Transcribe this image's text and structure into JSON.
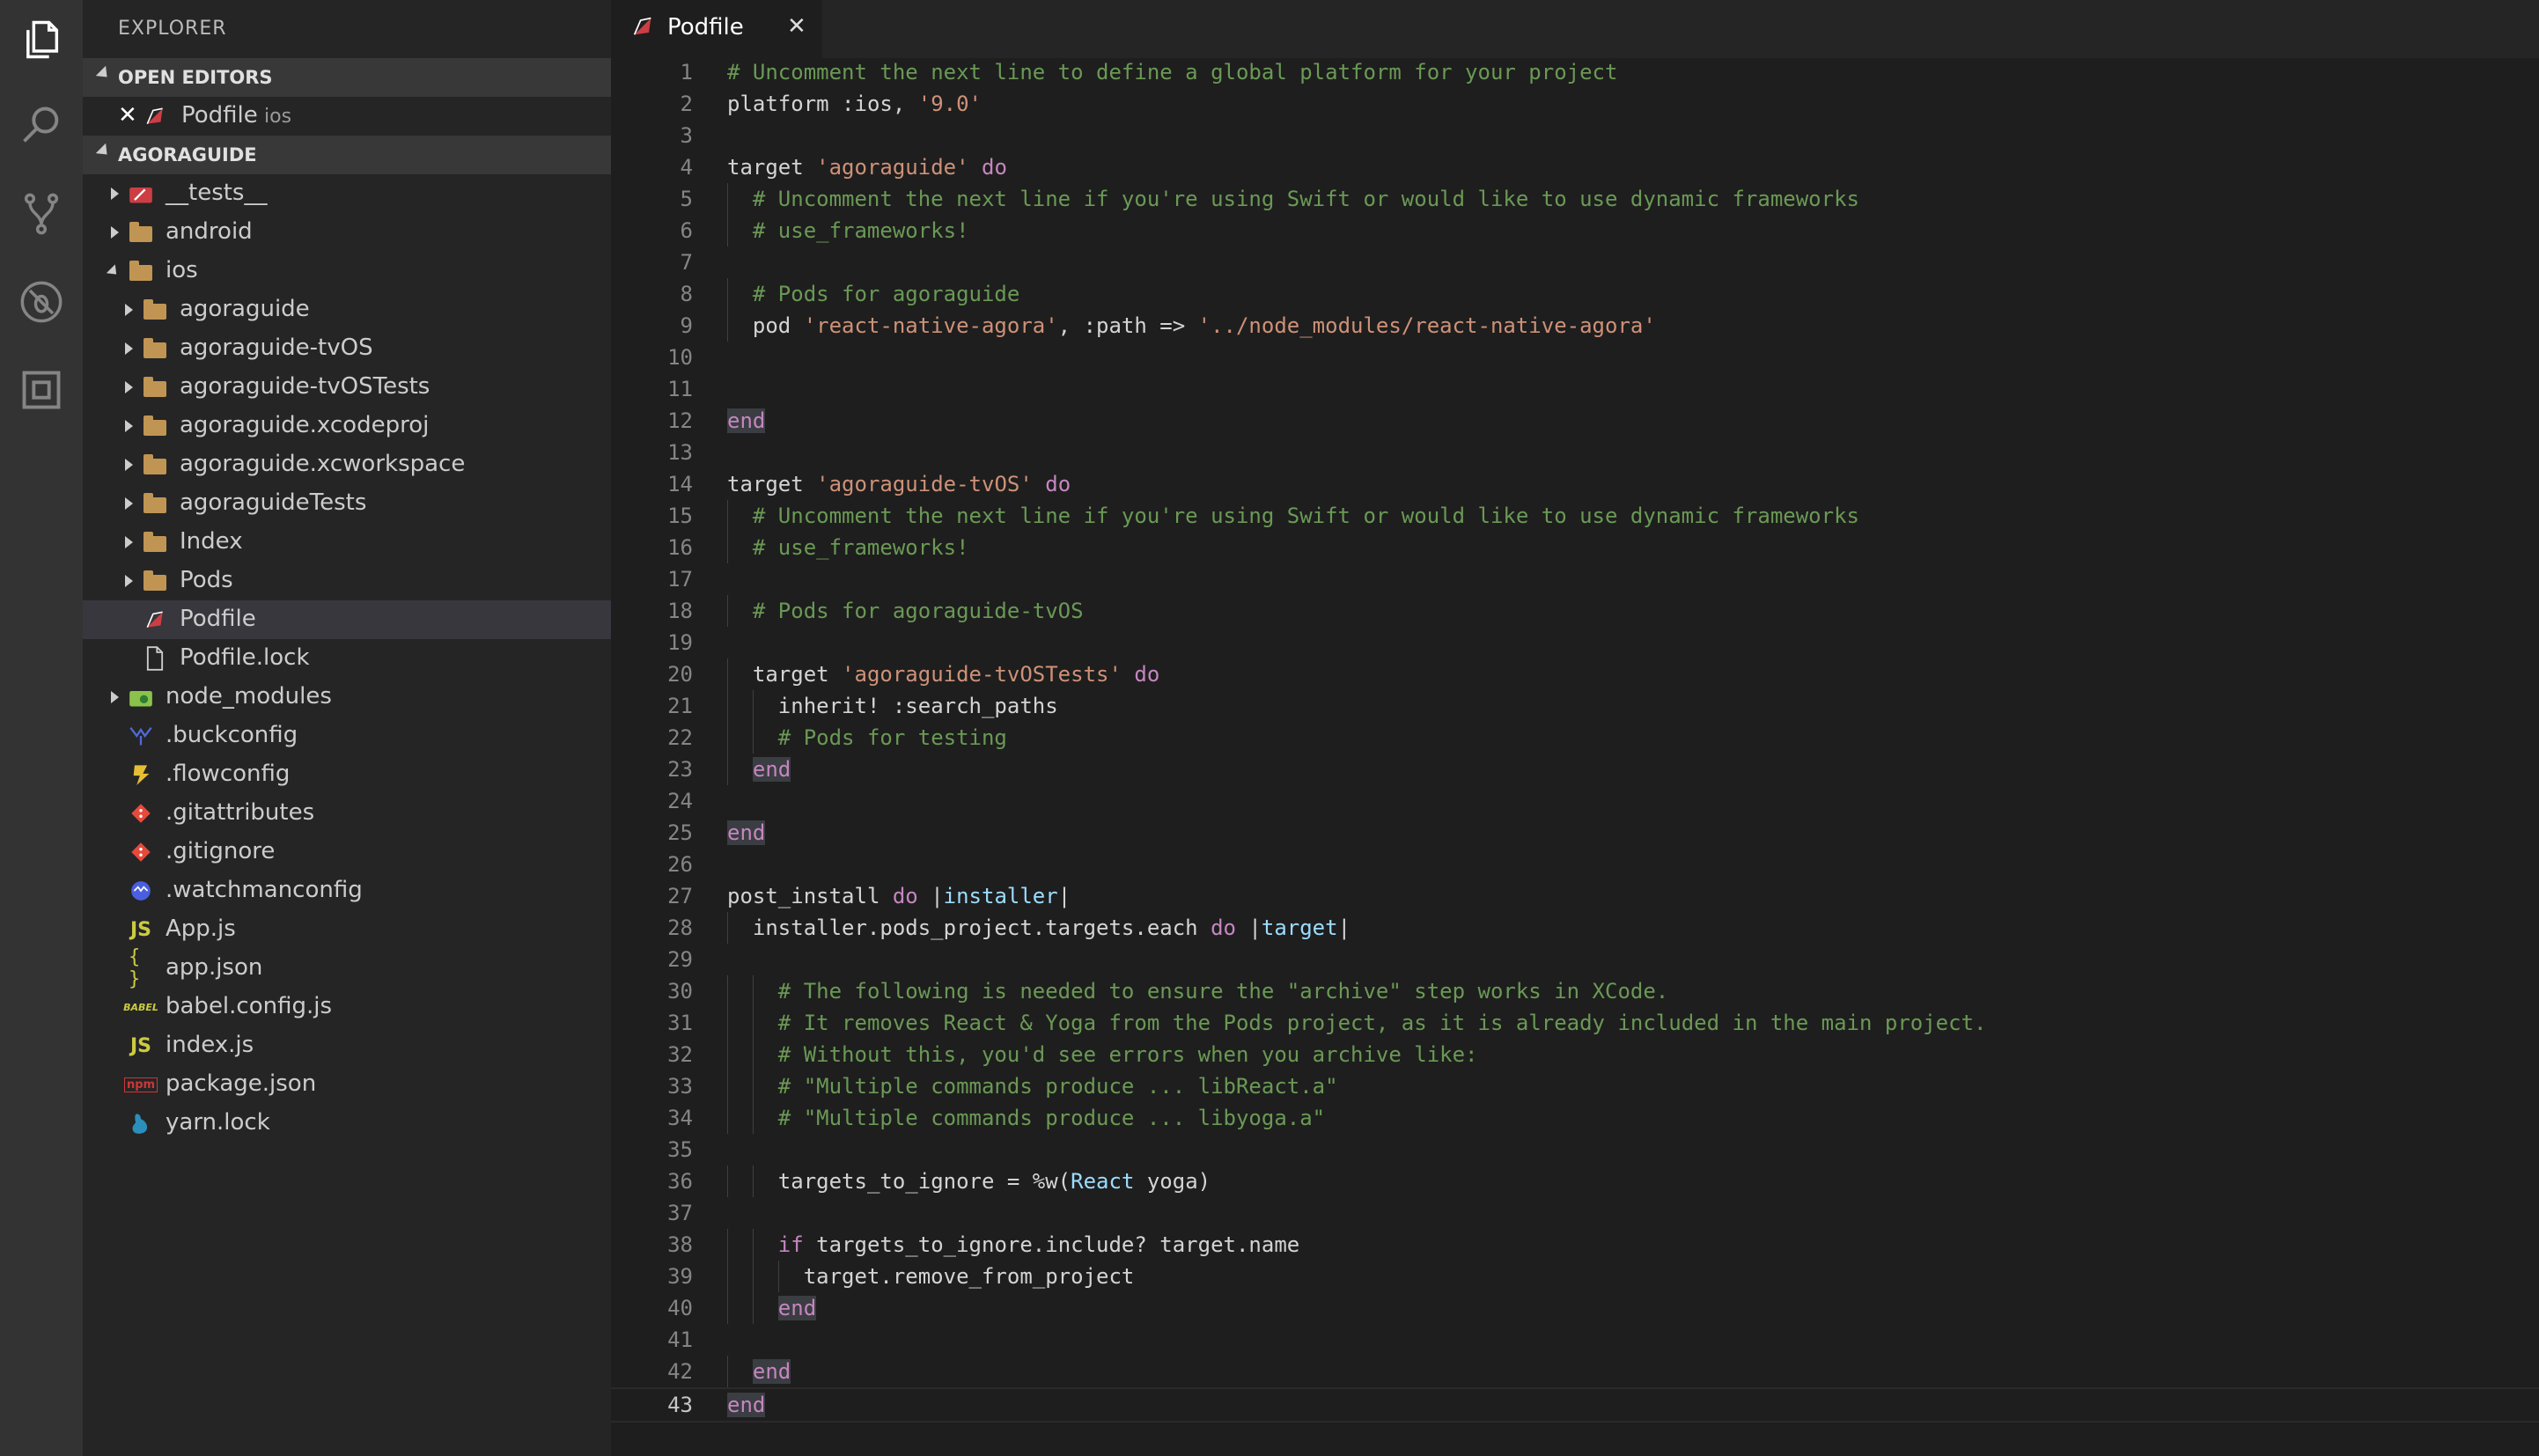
{
  "explorer": {
    "title": "EXPLORER",
    "open_editors_header": "OPEN EDITORS",
    "open_editor": {
      "name": "Podfile",
      "folder": "ios"
    },
    "project_header": "AGORAGUIDE"
  },
  "tree": [
    {
      "label": "__tests__",
      "depth": 0,
      "kind": "folder-tests",
      "expanded": false
    },
    {
      "label": "android",
      "depth": 0,
      "kind": "folder",
      "expanded": false
    },
    {
      "label": "ios",
      "depth": 0,
      "kind": "folder",
      "expanded": true
    },
    {
      "label": "agoraguide",
      "depth": 1,
      "kind": "folder",
      "expanded": false
    },
    {
      "label": "agoraguide-tvOS",
      "depth": 1,
      "kind": "folder",
      "expanded": false
    },
    {
      "label": "agoraguide-tvOSTests",
      "depth": 1,
      "kind": "folder",
      "expanded": false
    },
    {
      "label": "agoraguide.xcodeproj",
      "depth": 1,
      "kind": "folder",
      "expanded": false
    },
    {
      "label": "agoraguide.xcworkspace",
      "depth": 1,
      "kind": "folder",
      "expanded": false
    },
    {
      "label": "agoraguideTests",
      "depth": 1,
      "kind": "folder",
      "expanded": false
    },
    {
      "label": "Index",
      "depth": 1,
      "kind": "folder",
      "expanded": false
    },
    {
      "label": "Pods",
      "depth": 1,
      "kind": "folder",
      "expanded": false
    },
    {
      "label": "Podfile",
      "depth": 1,
      "kind": "ruby",
      "selected": true
    },
    {
      "label": "Podfile.lock",
      "depth": 1,
      "kind": "file"
    },
    {
      "label": "node_modules",
      "depth": 0,
      "kind": "folder-node",
      "expanded": false
    },
    {
      "label": ".buckconfig",
      "depth": 0,
      "kind": "buck"
    },
    {
      "label": ".flowconfig",
      "depth": 0,
      "kind": "flow"
    },
    {
      "label": ".gitattributes",
      "depth": 0,
      "kind": "git"
    },
    {
      "label": ".gitignore",
      "depth": 0,
      "kind": "git"
    },
    {
      "label": ".watchmanconfig",
      "depth": 0,
      "kind": "watchman"
    },
    {
      "label": "App.js",
      "depth": 0,
      "kind": "js"
    },
    {
      "label": "app.json",
      "depth": 0,
      "kind": "json"
    },
    {
      "label": "babel.config.js",
      "depth": 0,
      "kind": "babel"
    },
    {
      "label": "index.js",
      "depth": 0,
      "kind": "js"
    },
    {
      "label": "package.json",
      "depth": 0,
      "kind": "npm"
    },
    {
      "label": "yarn.lock",
      "depth": 0,
      "kind": "yarn"
    }
  ],
  "icons": {
    "js_glyph": "JS",
    "json_glyph": "{ }",
    "babel_glyph": "BABEL",
    "npm_glyph": "npm"
  },
  "tab": {
    "label": "Podfile",
    "close_glyph": "✕",
    "open_editor_close_glyph": "✕"
  },
  "editor": {
    "active_line": 43,
    "lines": [
      {
        "n": "1",
        "indent": 0,
        "tokens": [
          [
            "comment",
            "# Uncomment the next line to define a global platform for your project"
          ]
        ]
      },
      {
        "n": "2",
        "indent": 0,
        "tokens": [
          [
            "plain",
            "platform :ios, "
          ],
          [
            "string",
            "'9.0'"
          ]
        ]
      },
      {
        "n": "3",
        "indent": 0,
        "tokens": []
      },
      {
        "n": "4",
        "indent": 0,
        "tokens": [
          [
            "plain",
            "target "
          ],
          [
            "string",
            "'agoraguide'"
          ],
          [
            "plain",
            " "
          ],
          [
            "kw",
            "do"
          ]
        ]
      },
      {
        "n": "5",
        "indent": 1,
        "tokens": [
          [
            "comment",
            "# Uncomment the next line if you're using Swift or would like to use dynamic frameworks"
          ]
        ]
      },
      {
        "n": "6",
        "indent": 1,
        "tokens": [
          [
            "comment",
            "# use_frameworks!"
          ]
        ]
      },
      {
        "n": "7",
        "indent": 0,
        "tokens": []
      },
      {
        "n": "8",
        "indent": 1,
        "tokens": [
          [
            "comment",
            "# Pods for agoraguide"
          ]
        ]
      },
      {
        "n": "9",
        "indent": 1,
        "tokens": [
          [
            "plain",
            "pod "
          ],
          [
            "string",
            "'react-native-agora'"
          ],
          [
            "plain",
            ", :path => "
          ],
          [
            "string",
            "'../node_modules/react-native-agora'"
          ]
        ]
      },
      {
        "n": "10",
        "indent": 0,
        "tokens": []
      },
      {
        "n": "11",
        "indent": 0,
        "tokens": []
      },
      {
        "n": "12",
        "indent": 0,
        "tokens": [
          [
            "end",
            "end"
          ]
        ]
      },
      {
        "n": "13",
        "indent": 0,
        "tokens": []
      },
      {
        "n": "14",
        "indent": 0,
        "tokens": [
          [
            "plain",
            "target "
          ],
          [
            "string",
            "'agoraguide-tvOS'"
          ],
          [
            "plain",
            " "
          ],
          [
            "kw",
            "do"
          ]
        ]
      },
      {
        "n": "15",
        "indent": 1,
        "tokens": [
          [
            "comment",
            "# Uncomment the next line if you're using Swift or would like to use dynamic frameworks"
          ]
        ]
      },
      {
        "n": "16",
        "indent": 1,
        "tokens": [
          [
            "comment",
            "# use_frameworks!"
          ]
        ]
      },
      {
        "n": "17",
        "indent": 0,
        "tokens": []
      },
      {
        "n": "18",
        "indent": 1,
        "tokens": [
          [
            "comment",
            "# Pods for agoraguide-tvOS"
          ]
        ]
      },
      {
        "n": "19",
        "indent": 0,
        "tokens": []
      },
      {
        "n": "20",
        "indent": 1,
        "tokens": [
          [
            "plain",
            "target "
          ],
          [
            "string",
            "'agoraguide-tvOSTests'"
          ],
          [
            "plain",
            " "
          ],
          [
            "kw",
            "do"
          ]
        ]
      },
      {
        "n": "21",
        "indent": 2,
        "tokens": [
          [
            "plain",
            "inherit! :search_paths"
          ]
        ]
      },
      {
        "n": "22",
        "indent": 2,
        "tokens": [
          [
            "comment",
            "# Pods for testing"
          ]
        ]
      },
      {
        "n": "23",
        "indent": 1,
        "tokens": [
          [
            "end",
            "end"
          ]
        ]
      },
      {
        "n": "24",
        "indent": 0,
        "tokens": []
      },
      {
        "n": "25",
        "indent": 0,
        "tokens": [
          [
            "end",
            "end"
          ]
        ]
      },
      {
        "n": "26",
        "indent": 0,
        "tokens": []
      },
      {
        "n": "27",
        "indent": 0,
        "tokens": [
          [
            "plain",
            "post_install "
          ],
          [
            "kw",
            "do"
          ],
          [
            "plain",
            " |"
          ],
          [
            "var",
            "installer"
          ],
          [
            "plain",
            "|"
          ]
        ]
      },
      {
        "n": "28",
        "indent": 1,
        "tokens": [
          [
            "plain",
            "installer.pods_project.targets.each "
          ],
          [
            "kw",
            "do"
          ],
          [
            "plain",
            " |"
          ],
          [
            "var",
            "target"
          ],
          [
            "plain",
            "|"
          ]
        ]
      },
      {
        "n": "29",
        "indent": 0,
        "tokens": []
      },
      {
        "n": "30",
        "indent": 2,
        "tokens": [
          [
            "comment",
            "# The following is needed to ensure the \"archive\" step works in XCode."
          ]
        ]
      },
      {
        "n": "31",
        "indent": 2,
        "tokens": [
          [
            "comment",
            "# It removes React & Yoga from the Pods project, as it is already included in the main project."
          ]
        ]
      },
      {
        "n": "32",
        "indent": 2,
        "tokens": [
          [
            "comment",
            "# Without this, you'd see errors when you archive like:"
          ]
        ]
      },
      {
        "n": "33",
        "indent": 2,
        "tokens": [
          [
            "comment",
            "# \"Multiple commands produce ... libReact.a\""
          ]
        ]
      },
      {
        "n": "34",
        "indent": 2,
        "tokens": [
          [
            "comment",
            "# \"Multiple commands produce ... libyoga.a\""
          ]
        ]
      },
      {
        "n": "35",
        "indent": 0,
        "tokens": []
      },
      {
        "n": "36",
        "indent": 2,
        "tokens": [
          [
            "plain",
            "targets_to_ignore = %w("
          ],
          [
            "const",
            "React"
          ],
          [
            "plain",
            " yoga)"
          ]
        ]
      },
      {
        "n": "37",
        "indent": 0,
        "tokens": []
      },
      {
        "n": "38",
        "indent": 2,
        "tokens": [
          [
            "kw",
            "if"
          ],
          [
            "plain",
            " targets_to_ignore.include? target.name"
          ]
        ]
      },
      {
        "n": "39",
        "indent": 3,
        "tokens": [
          [
            "plain",
            "target.remove_from_project"
          ]
        ]
      },
      {
        "n": "40",
        "indent": 2,
        "tokens": [
          [
            "end",
            "end"
          ]
        ]
      },
      {
        "n": "41",
        "indent": 0,
        "tokens": []
      },
      {
        "n": "42",
        "indent": 1,
        "tokens": [
          [
            "end",
            "end"
          ]
        ]
      },
      {
        "n": "43",
        "indent": 0,
        "tokens": [
          [
            "end",
            "end"
          ]
        ]
      }
    ]
  }
}
